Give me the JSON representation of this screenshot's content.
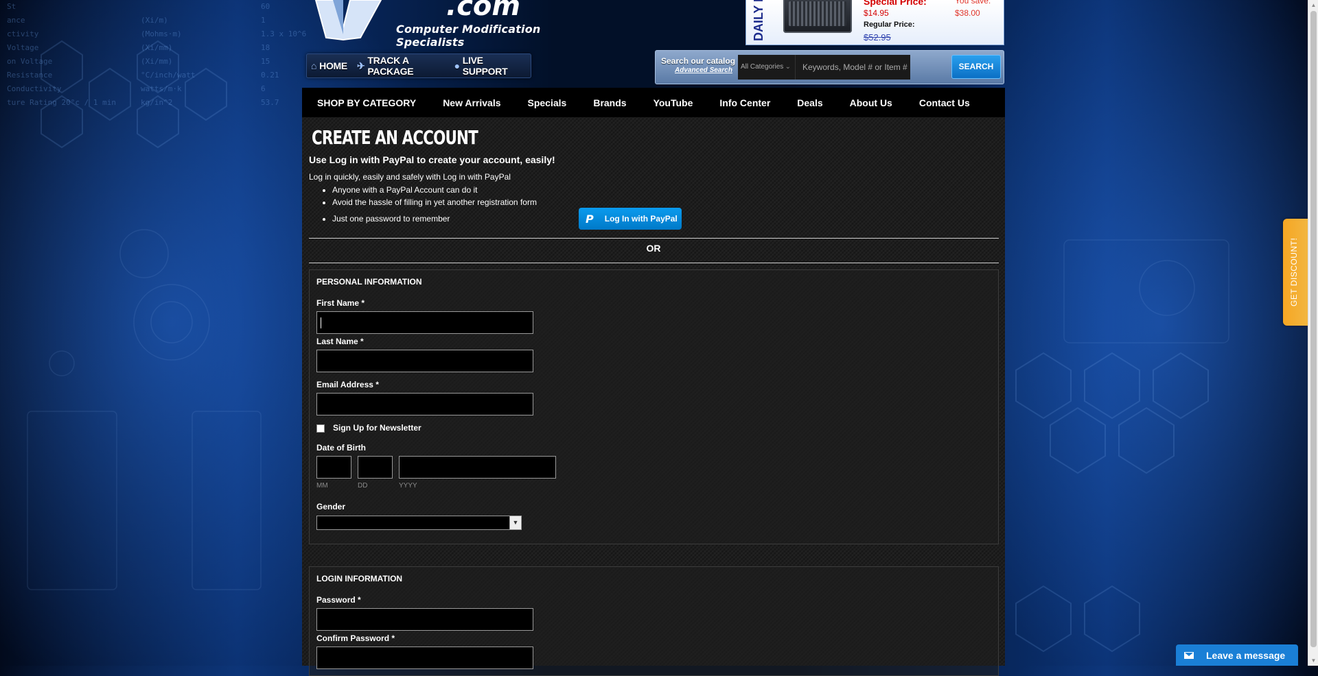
{
  "background_specs": [
    {
      "name": "St",
      "unit": "",
      "value": "60"
    },
    {
      "name": "ance",
      "unit": "(Xi/m)",
      "value": "1"
    },
    {
      "name": "ctivity",
      "unit": "(Mohms·m)",
      "value": "1.3 x 10^6"
    },
    {
      "name": "Voltage",
      "unit": "(Xi/mm)",
      "value": "18"
    },
    {
      "name": "on Voltage",
      "unit": "(Xi/mm)",
      "value": "15"
    },
    {
      "name": "Resistance",
      "unit": "°C/inch/watt",
      "value": "0.21"
    },
    {
      "name": "Conductivity",
      "unit": "watts/m·k",
      "value": "6"
    },
    {
      "name": "ture Rating 20°c / 1 min",
      "unit": "kg/in^2",
      "value": "53.7"
    }
  ],
  "logo": {
    "domain": ".com",
    "tagline": "Computer Modification Specialists"
  },
  "top_nav": {
    "items": [
      {
        "label": "HOME",
        "icon": "home-icon"
      },
      {
        "label": "TRACK A PACKAGE",
        "icon": "airplane-icon"
      },
      {
        "label": "LIVE SUPPORT",
        "icon": "chat-bubble-icon"
      }
    ]
  },
  "daily_deal": {
    "title": "DAILY D",
    "special_price_label": "Special Price:",
    "special_price": "$14.95",
    "you_save_label": "You save:",
    "you_save": "$38.00",
    "regular_price_label": "Regular Price:",
    "regular_price": "$52.95"
  },
  "search": {
    "label": "Search our catalog",
    "advanced_label": "Advanced Search",
    "category": "All Categories",
    "placeholder": "Keywords, Model # or Item #",
    "button": "SEARCH"
  },
  "main_nav": [
    "SHOP BY CATEGORY",
    "New Arrivals",
    "Specials",
    "Brands",
    "YouTube",
    "Info Center",
    "Deals",
    "About Us",
    "Contact Us"
  ],
  "page": {
    "title": "CREATE AN ACCOUNT",
    "paypal_headline": "Use Log in with PayPal to create your account, easily!",
    "paypal_intro": "Log in quickly, easily and safely with Log in with PayPal",
    "paypal_bullets": [
      "Anyone with a PayPal Account can do it",
      "Avoid the hassle of filling in yet another registration form",
      "Just one password to remember"
    ],
    "paypal_button": "Log In with PayPal",
    "paypal_button_glyph": "P",
    "or_text": "OR"
  },
  "personal_info": {
    "heading": "PERSONAL INFORMATION",
    "first_name_label": "First Name *",
    "last_name_label": "Last Name *",
    "email_label": "Email Address *",
    "newsletter_label": "Sign Up for Newsletter",
    "dob_label": "Date of Birth",
    "dob_hints": {
      "mm": "MM",
      "dd": "DD",
      "yyyy": "YYYY"
    },
    "gender_label": "Gender"
  },
  "login_info": {
    "heading": "LOGIN INFORMATION",
    "password_label": "Password *",
    "confirm_label": "Confirm Password *"
  },
  "discount_tab": "GET DISCOUNT!",
  "chat": {
    "label": "Leave a message"
  },
  "colors": {
    "accent_blue": "#0a9bee",
    "price_red": "#d40000",
    "discount_orange": "#f6a623",
    "chat_blue": "#1a7fd6"
  }
}
